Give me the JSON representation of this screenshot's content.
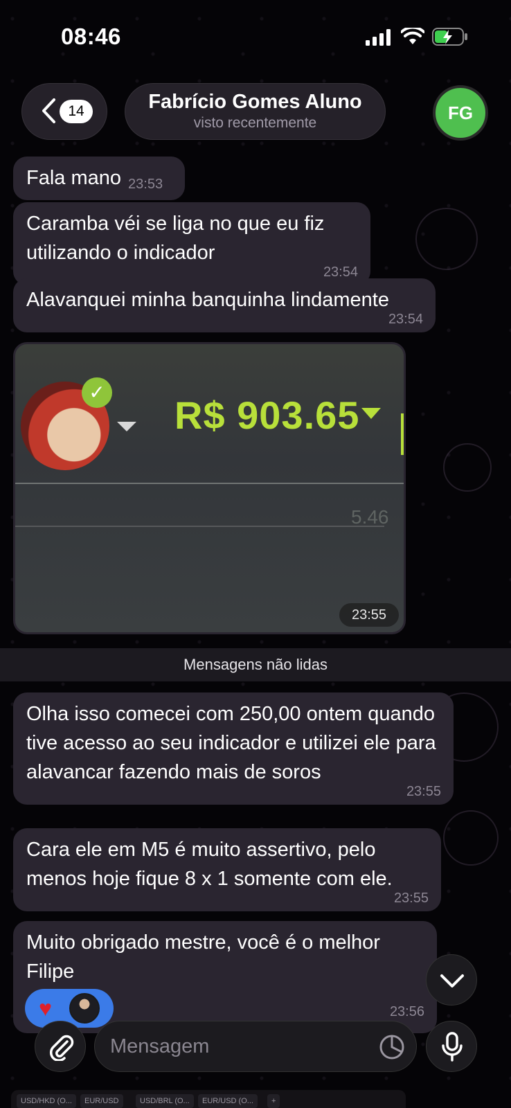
{
  "status_bar": {
    "time": "08:46"
  },
  "header": {
    "back_count": "14",
    "contact_name": "Fabrício Gomes Aluno",
    "contact_status": "visto recentemente",
    "avatar_initials": "FG",
    "avatar_color": "#4fbf4f"
  },
  "messages": [
    {
      "text": "Fala mano",
      "time": "23:53"
    },
    {
      "text": "Caramba véi se liga no que eu fiz utilizando o indicador",
      "time": "23:54"
    },
    {
      "text": "Alavanquei minha banquinha lindamente",
      "time": "23:54"
    },
    {
      "photo_amount": "R$ 903.65",
      "photo_faded": "5.46",
      "time": "23:55"
    },
    {
      "text": "Olha isso comecei com 250,00 ontem quando tive acesso ao seu indicador e utilizei ele para alavancar fazendo mais de soros",
      "time": "23:55"
    },
    {
      "text": "Cara ele em M5 é muito assertivo, pelo menos hoje fique 8 x 1 somente com ele.",
      "time": "23:55"
    },
    {
      "text": "Muito obrigado mestre, você é o melhor Filipe",
      "time": "23:56"
    }
  ],
  "unread_divider": "Mensagens não lidas",
  "reaction": {
    "emoji": "♥",
    "color": "#3b7be8"
  },
  "composer": {
    "placeholder": "Mensagem"
  },
  "background_tabs": [
    "USD/HKD (O...",
    "EUR/USD",
    "USD/BRL (O...",
    "EUR/USD (O...",
    "+"
  ]
}
